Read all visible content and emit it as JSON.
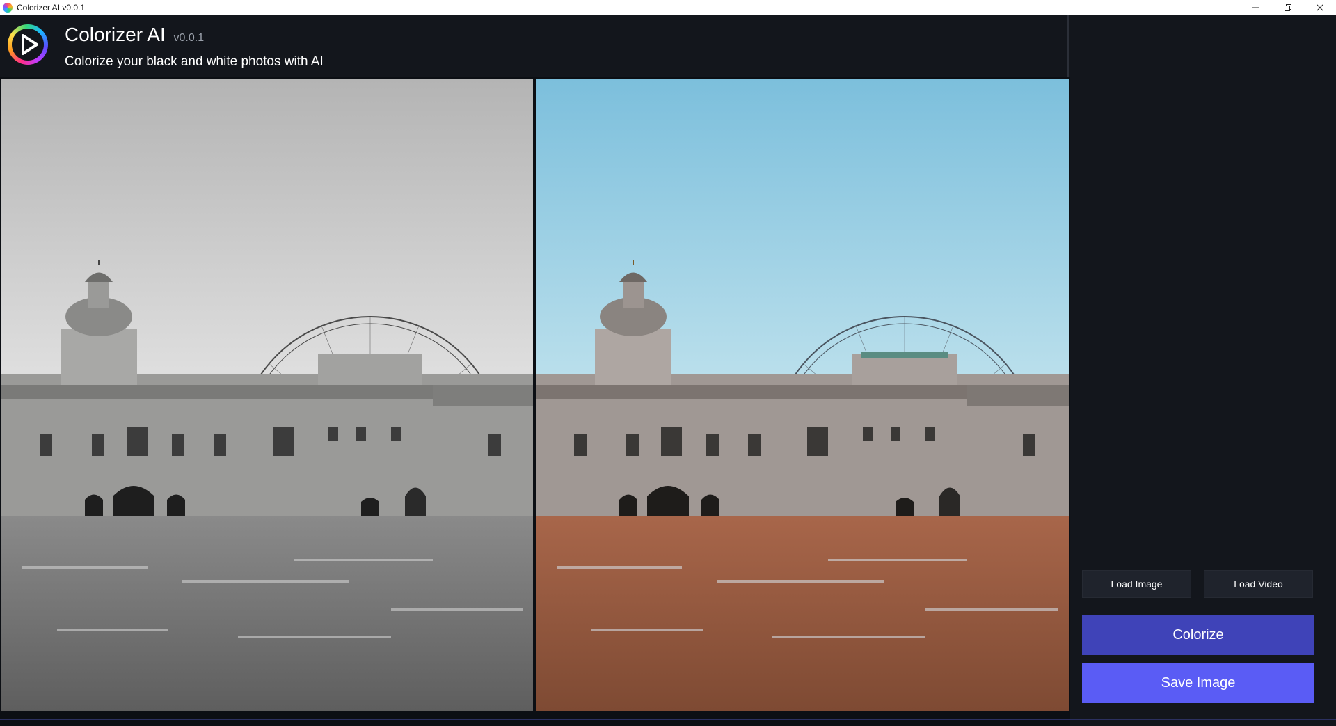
{
  "window": {
    "title": "Colorizer AI v0.0.1",
    "controls": [
      "minimize-icon",
      "restore-icon",
      "close-icon"
    ]
  },
  "header": {
    "app_name": "Colorizer AI",
    "version": "v0.0.1",
    "subtitle": "Colorize your black and white photos with AI",
    "logo_icon": "play-icon"
  },
  "panels": {
    "original": {
      "mode": "grayscale"
    },
    "colorized": {
      "mode": "color"
    }
  },
  "sidebar": {
    "load_image_label": "Load Image",
    "load_video_label": "Load Video",
    "colorize_label": "Colorize",
    "save_image_label": "Save Image"
  },
  "colors": {
    "background": "#13161c",
    "colorize_button": "#3f43b8",
    "save_button": "#5a5cf5",
    "secondary_button": "#1f232c"
  }
}
